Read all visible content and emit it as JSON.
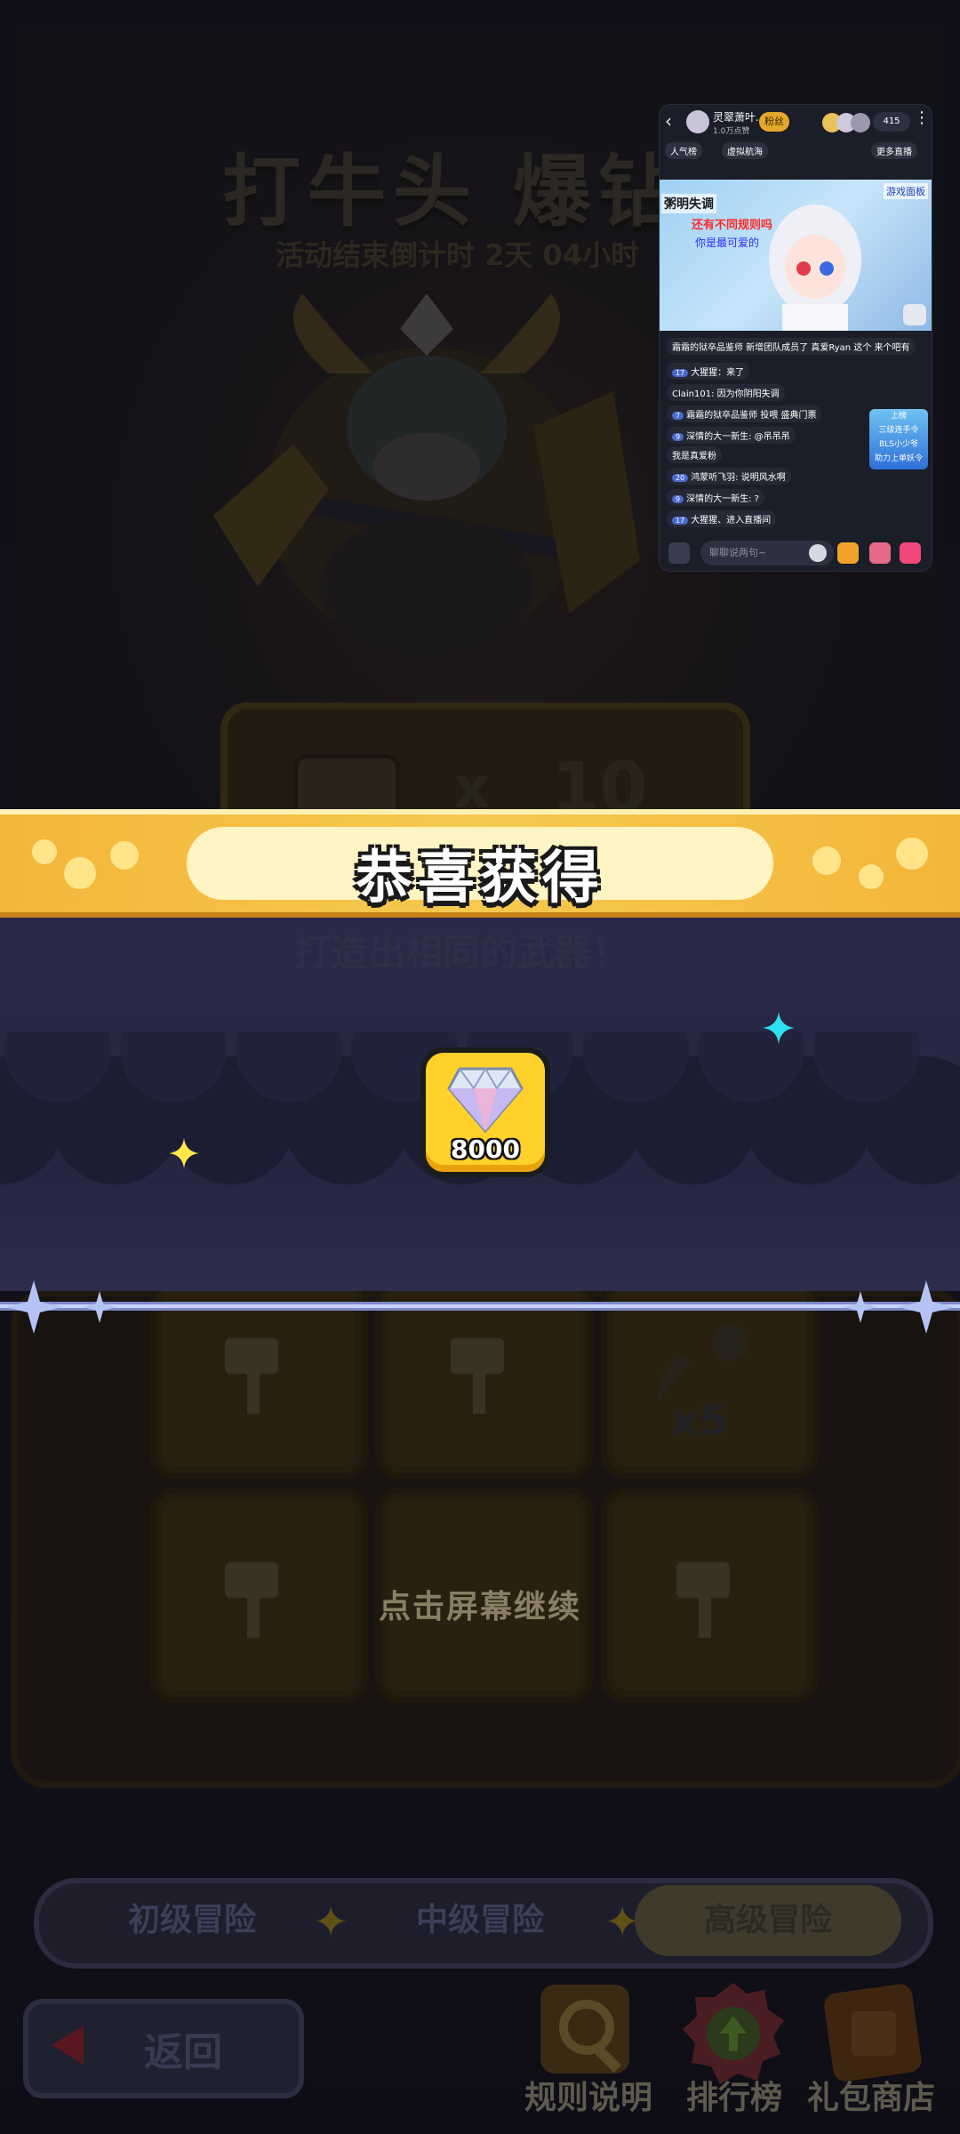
{
  "event": {
    "title": "打牛头 爆钻石",
    "countdown": "活动结束倒计时 2天 04小时",
    "prize_x": "x",
    "prize_count": "10",
    "stone_hint": "打造出相同的武器！"
  },
  "reward_popup": {
    "banner_text": "恭喜获得",
    "item_icon": "diamond-icon",
    "item_count": "8000",
    "continue_hint": "点击屏幕继续",
    "colors": {
      "banner": "#f6c94f",
      "tile": "#ffd12a",
      "spark_cyan": "#2ee0f0",
      "spark_yellow": "#ffe84a"
    }
  },
  "board": {
    "key_count": "x5"
  },
  "tabs": [
    {
      "label": "初级冒险",
      "active": false
    },
    {
      "label": "中级冒险",
      "active": false
    },
    {
      "label": "高级冒险",
      "active": true
    }
  ],
  "bottom_bar": {
    "back_label": "返回",
    "rules_label": "规则说明",
    "rank_label": "排行榜",
    "shop_label": "礼包商店"
  },
  "live": {
    "streamer_name": "灵翠萧叶...",
    "fans": "1.0万点赞",
    "badge": "粉丝",
    "viewer_count": "415",
    "tag_popularity": "人气榜",
    "tag_region": "虚拟航海",
    "tag_more": "更多直播",
    "video_text1": "粥明失调",
    "video_text2": "还有不同规则吗",
    "video_text3": "你是最可爱的",
    "video_tag": "游戏面板",
    "chat": [
      {
        "lvl": "",
        "text": "霜霜的狱卒品鉴师  新增团队成员了 真爱Ryan 这个 来个吧有"
      },
      {
        "lvl": "17",
        "text": "大猩猩：来了"
      },
      {
        "lvl": "",
        "text": "Clain101: 因为你阴阳失调"
      },
      {
        "lvl": "7",
        "text": "霜霜的狱卒品鉴师  投喂 盛典门票"
      },
      {
        "lvl": "9",
        "text": "深情的大一新生: @吊吊吊"
      },
      {
        "lvl": "",
        "text": "我是真爱粉"
      },
      {
        "lvl": "20",
        "text": "鸿蒙听飞羽: 说明风水啊"
      },
      {
        "lvl": "9",
        "text": "深情的大一新生: ?"
      },
      {
        "lvl": "17",
        "text": "大猩猩、进入直播间"
      }
    ],
    "promo_line1": "上榜",
    "promo_line2": "三级连手令",
    "promo_line3": "BLS小少爷",
    "promo_line4": "助力上单妖令",
    "input_placeholder": "聊聊说两句~"
  }
}
